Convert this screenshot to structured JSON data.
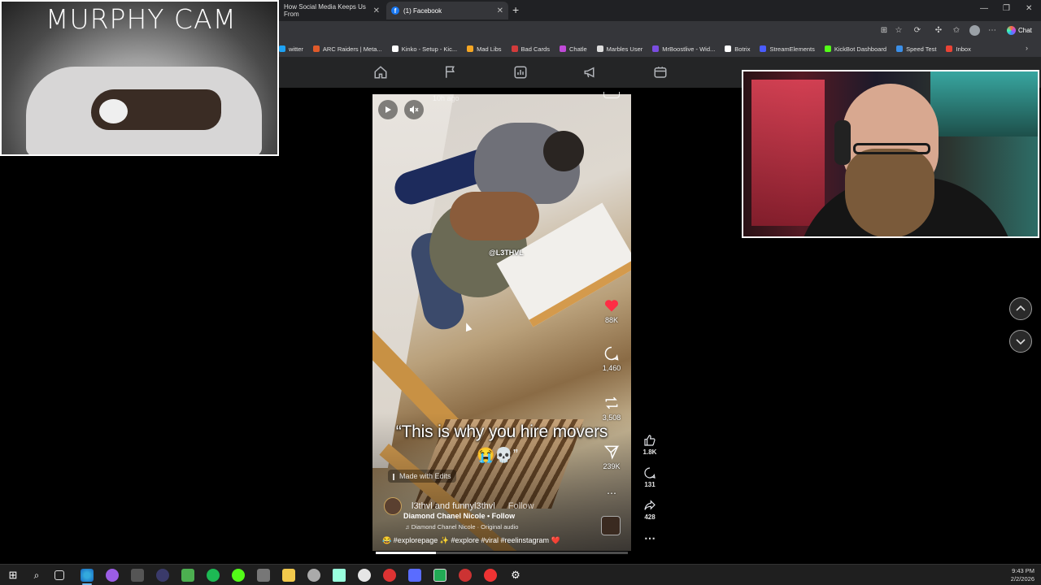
{
  "browser": {
    "tabs": [
      {
        "label": "How Social Media Keeps Us From",
        "active": false
      },
      {
        "label": "(1) Facebook",
        "active": true
      }
    ],
    "bookmarks": [
      {
        "label": "witter",
        "color": "#1da1f2"
      },
      {
        "label": "ARC Raiders | Meta...",
        "color": "#e05a2a"
      },
      {
        "label": "Kinko - Setup - Kic...",
        "color": "#ffffff"
      },
      {
        "label": "Mad Libs",
        "color": "#f5a623"
      },
      {
        "label": "Bad Cards",
        "color": "#d23b3b"
      },
      {
        "label": "Chatle",
        "color": "#c04ad8"
      },
      {
        "label": "Marbles User",
        "color": "#dddddd"
      },
      {
        "label": "MrBoostlive - Wid...",
        "color": "#7a4de0"
      },
      {
        "label": "Botrix",
        "color": "#ffffff"
      },
      {
        "label": "StreamElements",
        "color": "#4a5cff"
      },
      {
        "label": "KickBot Dashboard",
        "color": "#53fc18"
      },
      {
        "label": "Speed Test",
        "color": "#3b8fe8"
      },
      {
        "label": "Inbox",
        "color": "#ea4335"
      }
    ],
    "chat_label": "Chat",
    "notification_badge": "1"
  },
  "reel": {
    "time_ago": "10h ago",
    "watermark": "@L3THVL",
    "caption": "“This is why you hire movers",
    "caption_emoji": "😭💀”",
    "made_with": "Made with Edits",
    "ig_likes": "88K",
    "ig_comments": "1,460",
    "ig_reposts": "3,508",
    "ig_shares": "239K",
    "ig_users": "l3thvl and funnyl3thvl",
    "ig_follow": "Follow",
    "fb_author": "Diamond Chanel Nicole • Follow",
    "audio": "♫ Diamond Chanel Nicole · Original audio",
    "hashtags": "😂 #explorepage ✨ #explore #viral #reelinstagram ❤️",
    "progress": 0.24
  },
  "fb_actions": {
    "likes": "1.8K",
    "comments": "131",
    "shares": "428"
  },
  "overlay": {
    "murphy_title": "MURPHY CAM"
  },
  "taskbar": {
    "time": "9:43 PM",
    "date": "2/2/2026"
  }
}
